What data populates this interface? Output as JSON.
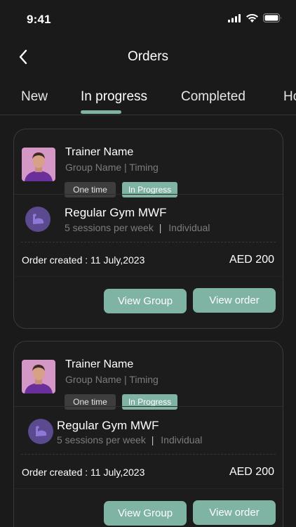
{
  "status_bar": {
    "time": "9:41"
  },
  "header": {
    "title": "Orders"
  },
  "tabs": [
    {
      "label": "New"
    },
    {
      "label": "In progress"
    },
    {
      "label": "Completed"
    },
    {
      "label": "Ho"
    }
  ],
  "active_tab_index": 1,
  "colors": {
    "accent": "#7fb3a4",
    "background": "#1a1a1a",
    "badge_gray": "#3d3d3d",
    "icon_purple": "#5b4a8f"
  },
  "orders": [
    {
      "trainer_name": "Trainer Name",
      "group_info": "Group Name | Timing",
      "type_badge": "One time",
      "status_badge": "In Progress",
      "plan_name": "Regular Gym MWF",
      "plan_sessions": "5 sessions per week",
      "plan_separator": "|",
      "plan_type": "Individual",
      "order_created": "Order created : 11 July,2023",
      "amount": "AED 200",
      "view_group_label": "View Group",
      "view_order_label": "View order"
    },
    {
      "trainer_name": "Trainer Name",
      "group_info": "Group Name | Timing",
      "type_badge": "One time",
      "status_badge": "In Progress",
      "plan_name": "Regular Gym MWF",
      "plan_sessions": "5 sessions per week",
      "plan_separator": "|",
      "plan_type": "Individual",
      "order_created": "Order created : 11 July,2023",
      "amount": "AED 200",
      "view_group_label": "View Group",
      "view_order_label": "View order"
    }
  ]
}
